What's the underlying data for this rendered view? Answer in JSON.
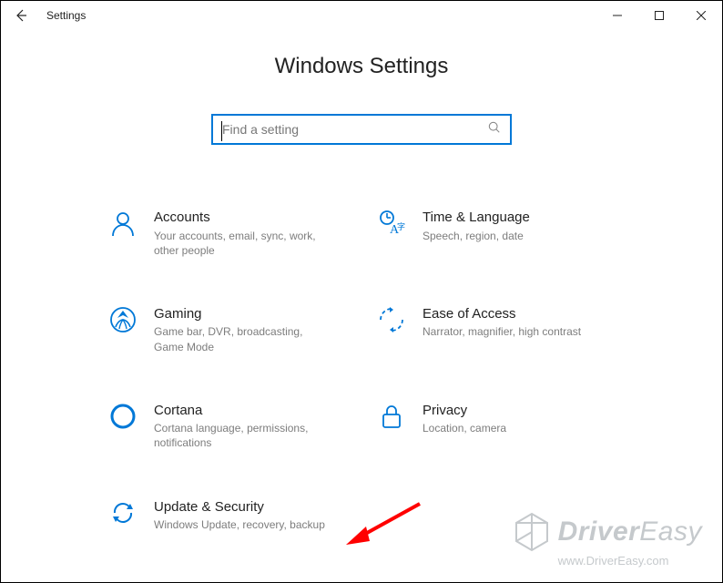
{
  "header": {
    "app_title": "Settings"
  },
  "page": {
    "title": "Windows Settings"
  },
  "search": {
    "placeholder": "Find a setting"
  },
  "tiles": {
    "accounts": {
      "title": "Accounts",
      "desc": "Your accounts, email, sync, work, other people"
    },
    "time": {
      "title": "Time & Language",
      "desc": "Speech, region, date"
    },
    "gaming": {
      "title": "Gaming",
      "desc": "Game bar, DVR, broadcasting, Game Mode"
    },
    "ease": {
      "title": "Ease of Access",
      "desc": "Narrator, magnifier, high contrast"
    },
    "cortana": {
      "title": "Cortana",
      "desc": "Cortana language, permissions, notifications"
    },
    "privacy": {
      "title": "Privacy",
      "desc": "Location, camera"
    },
    "update": {
      "title": "Update & Security",
      "desc": "Windows Update, recovery, backup"
    }
  },
  "watermark": {
    "brand1": "Driver",
    "brand2": "Easy",
    "url": "www.DriverEasy.com"
  }
}
